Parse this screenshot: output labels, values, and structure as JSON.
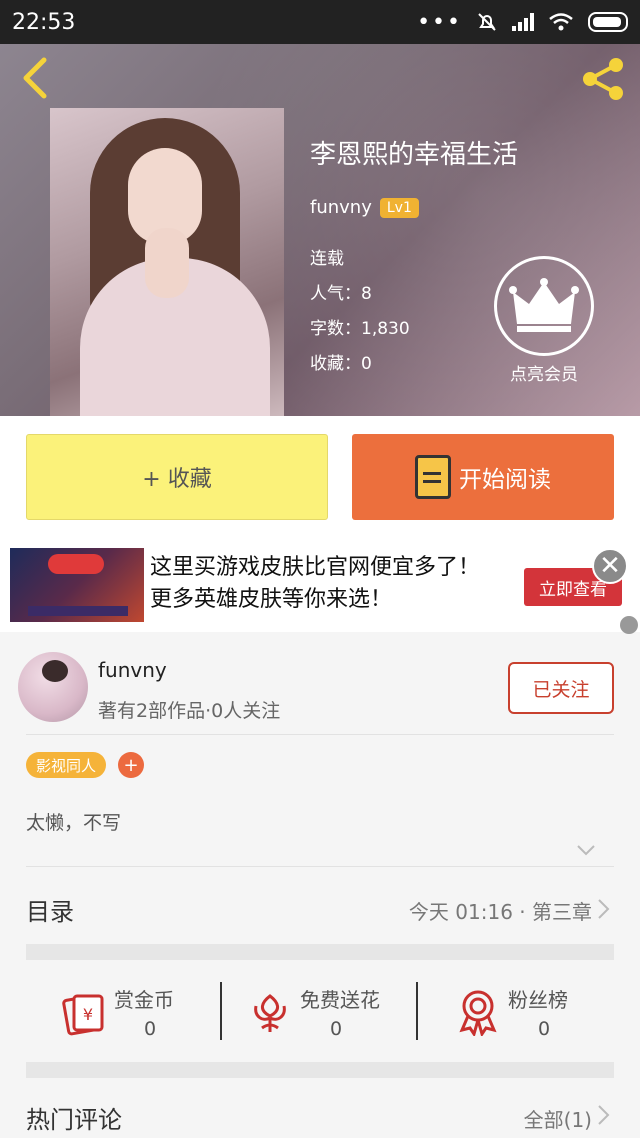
{
  "status_bar": {
    "time": "22:53",
    "dots": "•••"
  },
  "header": {
    "book_title": "李恩熙的幸福生活",
    "author": "funvny",
    "level": "Lv1",
    "status": "连载",
    "popularity": "人气：8",
    "word_count": "字数：1,830",
    "favorites": "收藏：0",
    "vip_label": "点亮会员"
  },
  "buttons": {
    "collect": "+ 收藏",
    "read": "开始阅读"
  },
  "ad": {
    "text": "这里买游戏皮肤比官网便宜多了！更多英雄皮肤等你来选！",
    "cta": "立即查看",
    "close": "✕"
  },
  "author_card": {
    "name": "funvny",
    "stats": "著有2部作品·0人关注",
    "follow": "已关注"
  },
  "tags": {
    "items": [
      "影视同人"
    ],
    "add": "+"
  },
  "intro": "太懒，不写",
  "toc": {
    "title": "目录",
    "latest": "今天 01:16 · 第三章"
  },
  "actions": [
    {
      "label": "赏金币",
      "count": "0",
      "icon": "gold-coin-icon"
    },
    {
      "label": "免费送花",
      "count": "0",
      "icon": "flower-icon"
    },
    {
      "label": "粉丝榜",
      "count": "0",
      "icon": "ribbon-medal-icon"
    }
  ],
  "hot_comments": {
    "title": "热门评论",
    "count": "全部(1)"
  },
  "colors": {
    "accent_orange": "#ec6f3d",
    "collect_yellow": "#fbf27a",
    "icon_yellow": "#f5d33a",
    "follow_red": "#c8402e"
  }
}
